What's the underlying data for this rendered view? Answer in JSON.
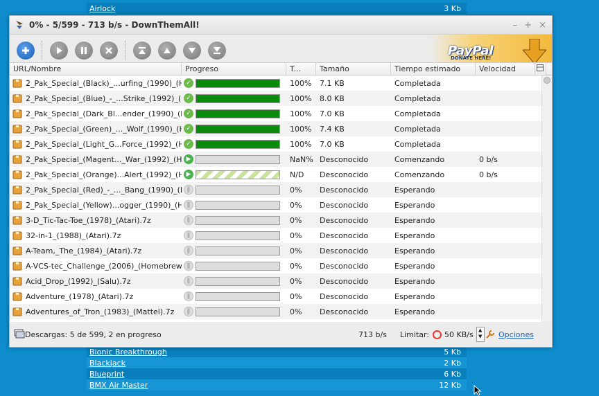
{
  "background_list": {
    "top": [
      {
        "name": "Airlock",
        "size": "3 Kb"
      }
    ],
    "bottom": [
      {
        "name": "Bionic Breakthrough",
        "size": "5 Kb"
      },
      {
        "name": "Blackjack",
        "size": "2 Kb"
      },
      {
        "name": "Blueprint",
        "size": "6 Kb"
      },
      {
        "name": "BMX Air Master",
        "size": "12 Kb"
      }
    ]
  },
  "window": {
    "title": "0% - 5/599 - 713 b/s - DownThemAll!",
    "controls": [
      "–",
      "+",
      "×"
    ]
  },
  "toolbar": {
    "buttons": [
      "add",
      "play",
      "pause",
      "cancel",
      "move-top",
      "move-up",
      "move-down",
      "move-bottom"
    ],
    "paypal_text": "PayPal",
    "paypal_sub": "DONATE HERE!"
  },
  "columns": [
    "URL/Nombre",
    "Progreso",
    "T...",
    "Tamaño",
    "Tiempo estimado",
    "Velocidad"
  ],
  "rows": [
    {
      "name": "2_Pak_Special_(Black)_...urfing_(1990)_(HES).7z",
      "status": "done",
      "progress": 1.0,
      "pct": "100%",
      "size": "7.1 KB",
      "eta": "Completada",
      "speed": ""
    },
    {
      "name": "2_Pak_Special_(Blue)_-_...Strike_(1992)_(HES).7z",
      "status": "done",
      "progress": 1.0,
      "pct": "100%",
      "size": "8.0 KB",
      "eta": "Completada",
      "speed": ""
    },
    {
      "name": "2_Pak_Special_(Dark_Bl...ender_(1990)_(HES).7z",
      "status": "done",
      "progress": 1.0,
      "pct": "100%",
      "size": "7.0 KB",
      "eta": "Completada",
      "speed": ""
    },
    {
      "name": "2_Pak_Special_(Green)_..._Wolf_(1990)_(HES).7z",
      "status": "done",
      "progress": 1.0,
      "pct": "100%",
      "size": "7.4 KB",
      "eta": "Completada",
      "speed": ""
    },
    {
      "name": "2_Pak_Special_(Light_G...Force_(1992)_(HES).7z",
      "status": "done",
      "progress": 1.0,
      "pct": "100%",
      "size": "7.0 KB",
      "eta": "Completada",
      "speed": ""
    },
    {
      "name": "2_Pak_Special_(Magent..._War_(1992)_(HES).7z",
      "status": "run",
      "progress": 0,
      "pct": "NaN%",
      "size": "Desconocido",
      "eta": "Comenzando",
      "speed": "0 b/s"
    },
    {
      "name": "2_Pak_Special_(Orange)...Alert_(1992)_(HES).7z",
      "status": "run-striped",
      "progress": 0,
      "pct": "N/D",
      "size": "Desconocido",
      "eta": "Comenzando",
      "speed": "0 b/s"
    },
    {
      "name": "2_Pak_Special_(Red)_-_..._Bang_(1990)_(HES).7z",
      "status": "wait",
      "progress": 0,
      "pct": "0%",
      "size": "Desconocido",
      "eta": "Esperando",
      "speed": ""
    },
    {
      "name": "2_Pak_Special_(Yellow)...ogger_(1990)_(HES).7z",
      "status": "wait",
      "progress": 0,
      "pct": "0%",
      "size": "Desconocido",
      "eta": "Esperando",
      "speed": ""
    },
    {
      "name": "3-D_Tic-Tac-Toe_(1978)_(Atari).7z",
      "status": "wait",
      "progress": 0,
      "pct": "0%",
      "size": "Desconocido",
      "eta": "Esperando",
      "speed": ""
    },
    {
      "name": "32-in-1_(1988)_(Atari).7z",
      "status": "wait",
      "progress": 0,
      "pct": "0%",
      "size": "Desconocido",
      "eta": "Esperando",
      "speed": ""
    },
    {
      "name": "A-Team,_The_(1984)_(Atari).7z",
      "status": "wait",
      "progress": 0,
      "pct": "0%",
      "size": "Desconocido",
      "eta": "Esperando",
      "speed": ""
    },
    {
      "name": "A-VCS-tec_Challenge_(2006)_(Homebrew).7z",
      "status": "wait",
      "progress": 0,
      "pct": "0%",
      "size": "Desconocido",
      "eta": "Esperando",
      "speed": ""
    },
    {
      "name": "Acid_Drop_(1992)_(Salu).7z",
      "status": "wait",
      "progress": 0,
      "pct": "0%",
      "size": "Desconocido",
      "eta": "Esperando",
      "speed": ""
    },
    {
      "name": "Adventure_(1978)_(Atari).7z",
      "status": "wait",
      "progress": 0,
      "pct": "0%",
      "size": "Desconocido",
      "eta": "Esperando",
      "speed": ""
    },
    {
      "name": "Adventures_of_Tron_(1983)_(Mattel).7z",
      "status": "wait",
      "progress": 0,
      "pct": "0%",
      "size": "Desconocido",
      "eta": "Esperando",
      "speed": ""
    }
  ],
  "statusbar": {
    "summary": "Descargas: 5 de 599, 2 en progreso",
    "speed": "713 b/s",
    "limit_label": "Limitar:",
    "limit_value": "50 KB/s",
    "options_label": "Opciones"
  },
  "colors": {
    "progress_done": "#0a8a0a",
    "background": "#0e8ccc",
    "link": "#1a5fb4"
  }
}
